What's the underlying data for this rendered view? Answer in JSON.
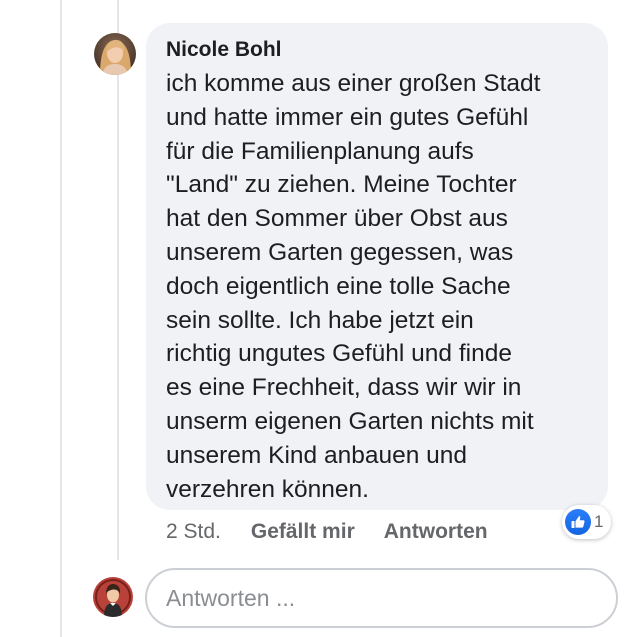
{
  "comment": {
    "author": "Nicole Bohl",
    "text": "ich komme aus einer großen Stadt\nund hatte immer ein gutes Gefühl\nfür die Familienplanung aufs\n\"Land\" zu ziehen. Meine Tochter\nhat den Sommer über Obst aus\nunserem Garten gegessen, was\ndoch eigentlich eine tolle Sache\nsein sollte. Ich habe jetzt ein\nrichtig ungutes Gefühl und finde\nes eine Frechheit, dass wir wir in\nunserm eigenen Garten nichts mit\nunserem Kind anbauen und\nverzehren können.",
    "time": "2 Std.",
    "like_label": "Gefällt mir",
    "reply_label": "Antworten",
    "reactions": {
      "icon": "like-thumb-icon",
      "count": "1"
    }
  },
  "reply_box": {
    "placeholder": "Antworten ..."
  },
  "colors": {
    "bubble": "#f0f2f5",
    "like_blue": "#1877f2",
    "muted_text": "#65676b"
  }
}
